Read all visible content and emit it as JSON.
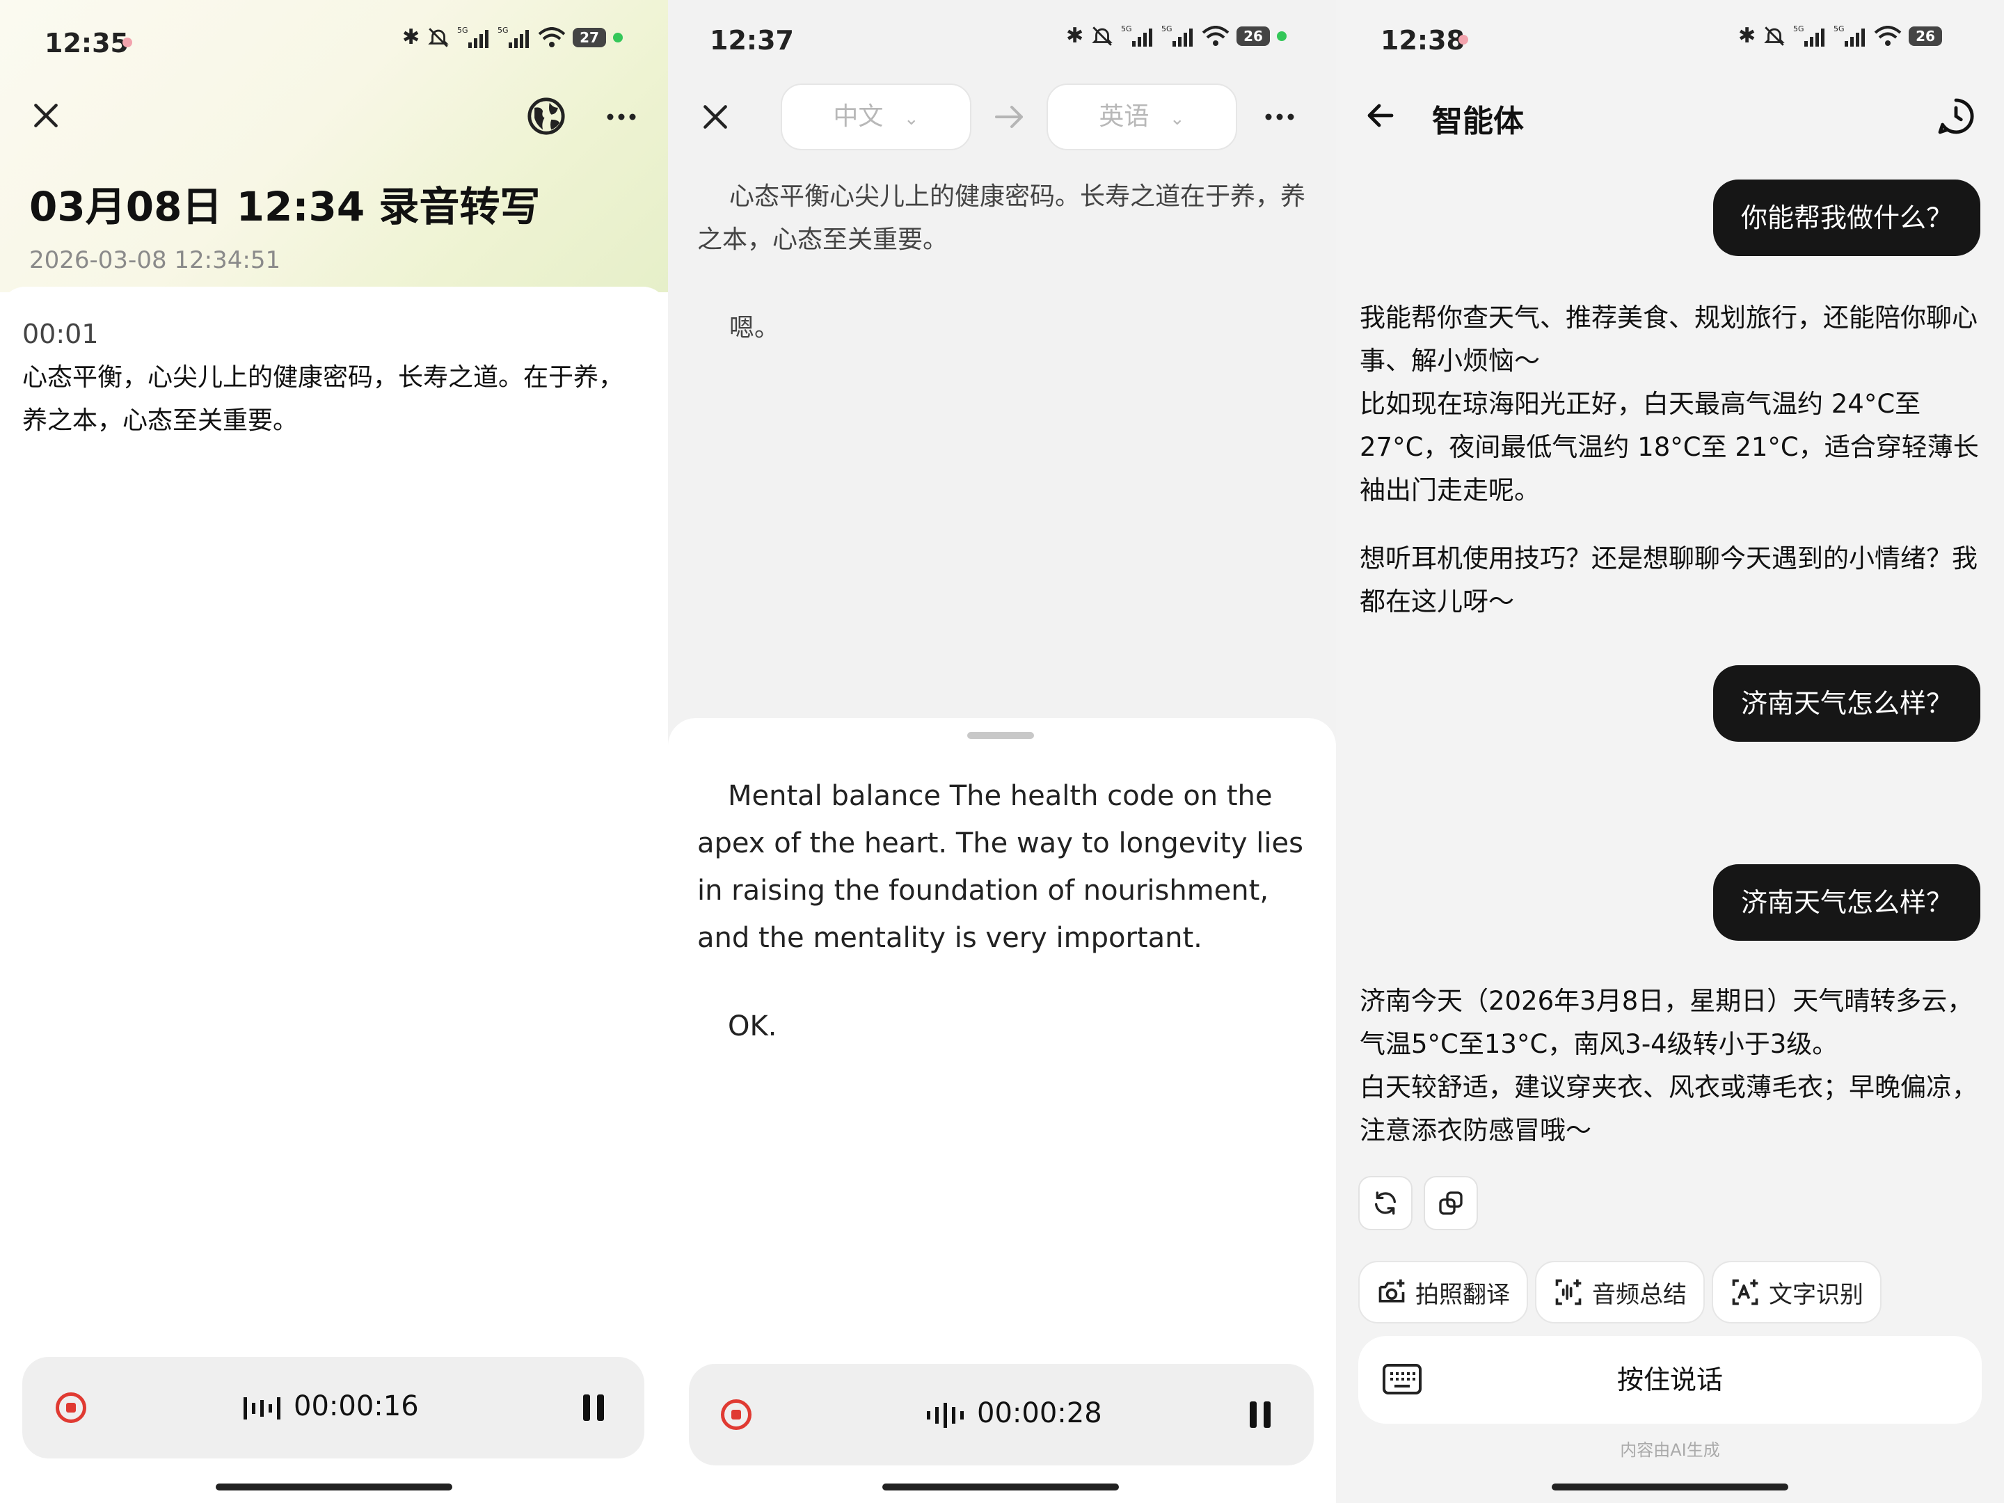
{
  "panel1": {
    "status": {
      "time": "12:35",
      "battery": "27"
    },
    "title": "03月08日 12:34 录音转写",
    "subtitle": "2026-03-08 12:34:51",
    "segment": {
      "timestamp": "00:01",
      "text": "心态平衡，心尖儿上的健康密码，长寿之道。在于养，养之本，心态至关重要。"
    },
    "recorder": {
      "time": "00:00:16"
    }
  },
  "panel2": {
    "status": {
      "time": "12:37",
      "battery": "26"
    },
    "source_lang": "中文",
    "target_lang": "英语",
    "source_text": "心态平衡心尖儿上的健康密码。长寿之道在于养，养之本，心态至关重要。",
    "source_text_2": "嗯。",
    "translation": "Mental balance The health code on the apex of the heart. The way to longevity lies in raising the foundation of nourishment, and the mentality is very important.",
    "translation_2": "OK.",
    "recorder": {
      "time": "00:00:28"
    }
  },
  "panel3": {
    "status": {
      "time": "12:38",
      "battery": "26"
    },
    "title": "智能体",
    "messages": {
      "user1": "你能帮我做什么？",
      "ai1_p1": "我能帮你查天气、推荐美食、规划旅行，还能陪你聊心事、解小烦恼～",
      "ai1_p2": "比如现在琼海阳光正好，白天最高气温约 24°C至 27°C，夜间最低气温约 18°C至 21°C，适合穿轻薄长袖出门走走呢。",
      "ai1_p3": "想听耳机使用技巧？还是想聊聊今天遇到的小情绪？我都在这儿呀～",
      "user2": "济南天气怎么样？",
      "user3": "济南天气怎么样？",
      "ai2_p1": "济南今天（2026年3月8日，星期日）天气晴转多云，气温5°C至13°C，南风3-4级转小于3级。",
      "ai2_p2": "白天较舒适，建议穿夹衣、风衣或薄毛衣；早晚偏凉，注意添衣防感冒哦～"
    },
    "chips": [
      "拍照翻译",
      "音频总结",
      "文字识别"
    ],
    "input_label": "按住说话",
    "footer": "内容由AI生成"
  }
}
